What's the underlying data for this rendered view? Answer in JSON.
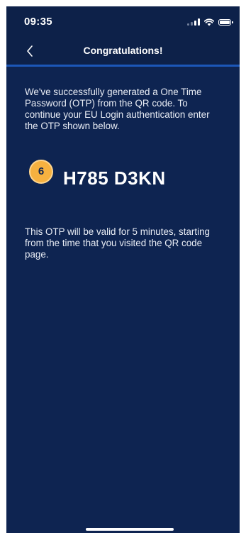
{
  "status_bar": {
    "time": "09:35",
    "icons": [
      "signal-icon",
      "wifi-icon",
      "battery-icon"
    ]
  },
  "nav": {
    "back_icon": "chevron-left-icon",
    "title": "Congratulations!"
  },
  "main": {
    "intro_text": "We've successfully generated a One Time Password (OTP) from the QR code. To continue your EU Login authentication enter the OTP shown below.",
    "step_badge": "6",
    "otp_code": "H785 D3KN",
    "validity_text": "This OTP will be valid for 5 minutes, starting from the time that you visited the QR code page."
  },
  "colors": {
    "background": "#0e2451",
    "accent_line": "#1c57b8",
    "badge": "#f6b140",
    "text": "#ffffff"
  }
}
